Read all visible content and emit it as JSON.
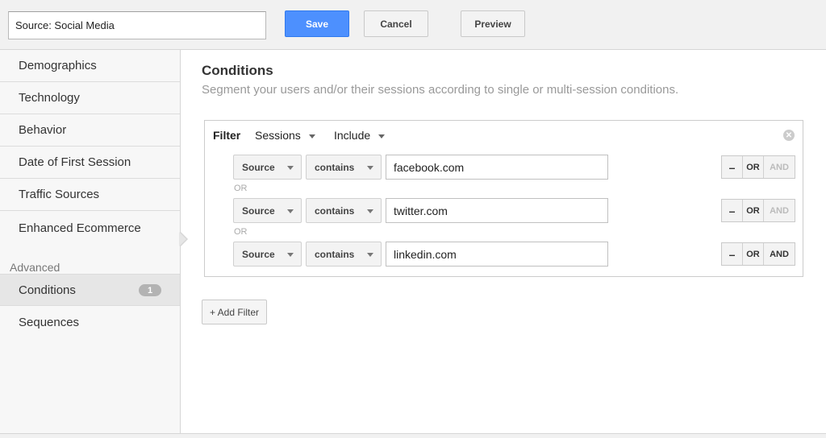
{
  "header": {
    "segment_name": "Source: Social Media",
    "save_label": "Save",
    "cancel_label": "Cancel",
    "preview_label": "Preview"
  },
  "sidebar": {
    "items": [
      {
        "label": "Demographics"
      },
      {
        "label": "Technology"
      },
      {
        "label": "Behavior"
      },
      {
        "label": "Date of First Session"
      },
      {
        "label": "Traffic Sources"
      },
      {
        "label": "Enhanced Ecommerce"
      }
    ],
    "advanced_heading": "Advanced",
    "advanced_items": [
      {
        "label": "Conditions",
        "badge": "1",
        "active": true
      },
      {
        "label": "Sequences",
        "active": false
      }
    ]
  },
  "main": {
    "title": "Conditions",
    "subtitle": "Segment your users and/or their sessions according to single or multi-session conditions.",
    "filter": {
      "label": "Filter",
      "scope": "Sessions",
      "mode": "Include",
      "rows": [
        {
          "dimension": "Source",
          "operator": "contains",
          "value": "facebook.com"
        },
        {
          "dimension": "Source",
          "operator": "contains",
          "value": "twitter.com"
        },
        {
          "dimension": "Source",
          "operator": "contains",
          "value": "linkedin.com"
        }
      ],
      "or_separator": "OR",
      "remove_label": "–",
      "or_label": "OR",
      "and_label": "AND"
    },
    "add_filter_label": "+ Add Filter"
  },
  "colors": {
    "save_button": "#4d90fe",
    "sidebar_bg": "#f7f7f7",
    "active_item_bg": "#e6e6e6",
    "badge_bg": "#b3b3b3"
  }
}
